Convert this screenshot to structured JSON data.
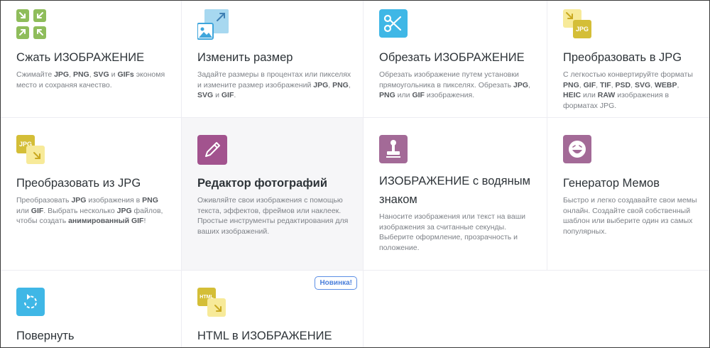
{
  "colors": {
    "compress": "#8fbd5b",
    "resize": "#a7d8f0",
    "crop": "#3fb7e6",
    "jpg": "#d4be37",
    "jpg_light": "#f7ea99",
    "editor": "#a2538e",
    "watermark": "#a36a97",
    "meme": "#a36a97",
    "rotate": "#3fb7e6",
    "badge": "#4b7fdb"
  },
  "tools": [
    {
      "title": "Сжать ИЗОБРАЖЕНИЕ",
      "icon": "compress-arrows-icon",
      "desc": [
        {
          "t": "Сжимайте "
        },
        {
          "t": "JPG",
          "b": true
        },
        {
          "t": ", "
        },
        {
          "t": "PNG",
          "b": true
        },
        {
          "t": ", "
        },
        {
          "t": "SVG",
          "b": true
        },
        {
          "t": " и "
        },
        {
          "t": "GIFs",
          "b": true
        },
        {
          "t": " экономя место и сохраняя качество."
        }
      ]
    },
    {
      "title": "Изменить размер",
      "icon": "resize-image-icon",
      "desc": [
        {
          "t": "Задайте размеры в процентах или пикселях и измените размер изображений "
        },
        {
          "t": "JPG",
          "b": true
        },
        {
          "t": ", "
        },
        {
          "t": "PNG",
          "b": true
        },
        {
          "t": ", "
        },
        {
          "t": "SVG",
          "b": true
        },
        {
          "t": " и "
        },
        {
          "t": "GIF",
          "b": true
        },
        {
          "t": "."
        }
      ]
    },
    {
      "title": "Обрезать ИЗОБРАЖЕНИЕ",
      "icon": "scissors-icon",
      "desc": [
        {
          "t": "Обрезать изображение путем установки прямоугольника в пикселях. Обрезать "
        },
        {
          "t": "JPG",
          "b": true
        },
        {
          "t": ", "
        },
        {
          "t": "PNG",
          "b": true
        },
        {
          "t": " или "
        },
        {
          "t": "GIF",
          "b": true
        },
        {
          "t": " изображения."
        }
      ]
    },
    {
      "title": "Преобразовать в JPG",
      "icon": "convert-to-jpg-icon",
      "icon_label": "JPG",
      "desc": [
        {
          "t": "С легкостью конвертируйте форматы "
        },
        {
          "t": "PNG",
          "b": true
        },
        {
          "t": ", "
        },
        {
          "t": "GIF",
          "b": true
        },
        {
          "t": ", "
        },
        {
          "t": "TIF",
          "b": true
        },
        {
          "t": ", "
        },
        {
          "t": "PSD",
          "b": true
        },
        {
          "t": ", "
        },
        {
          "t": "SVG",
          "b": true
        },
        {
          "t": ", "
        },
        {
          "t": "WEBP",
          "b": true
        },
        {
          "t": ", "
        },
        {
          "t": "HEIC",
          "b": true
        },
        {
          "t": " или "
        },
        {
          "t": "RAW",
          "b": true
        },
        {
          "t": " изображения в форматах JPG."
        }
      ]
    },
    {
      "title": "Преобразовать из JPG",
      "icon": "convert-from-jpg-icon",
      "icon_label": "JPG",
      "desc": [
        {
          "t": "Преобразовать "
        },
        {
          "t": "JPG",
          "b": true
        },
        {
          "t": " изображения в "
        },
        {
          "t": "PNG",
          "b": true
        },
        {
          "t": " или "
        },
        {
          "t": "GIF",
          "b": true
        },
        {
          "t": ". Выбрать несколько "
        },
        {
          "t": "JPG",
          "b": true
        },
        {
          "t": " файлов, чтобы создать "
        },
        {
          "t": "анимированный GIF",
          "b": true
        },
        {
          "t": "!"
        }
      ]
    },
    {
      "title": "Редактор фотографий",
      "icon": "pencil-icon",
      "desc": [
        {
          "t": "Оживляйте свои изображения с помощью текста, эффектов, фреймов или наклеек. Простые инструменты редактирования для ваших изображений."
        }
      ]
    },
    {
      "title": "ИЗОБРАЖЕНИЕ с водяным знаком",
      "icon": "stamp-icon",
      "desc": [
        {
          "t": "Наносите изображения или текст на ваши изображения за считанные секунды. Выберите оформление, прозрачность и положение."
        }
      ]
    },
    {
      "title": "Генератор Мемов",
      "icon": "laughing-face-icon",
      "desc": [
        {
          "t": "Быстро и легко создавайте свои мемы онлайн. Создайте свой собственный шаблон или выберите один из самых популярных."
        }
      ]
    },
    {
      "title": "Повернуть",
      "icon": "rotate-icon",
      "desc": []
    },
    {
      "title": "HTML в ИЗОБРАЖЕНИЕ",
      "icon": "html-to-image-icon",
      "icon_label": "HTML",
      "badge": "Новинка!",
      "desc": []
    }
  ]
}
